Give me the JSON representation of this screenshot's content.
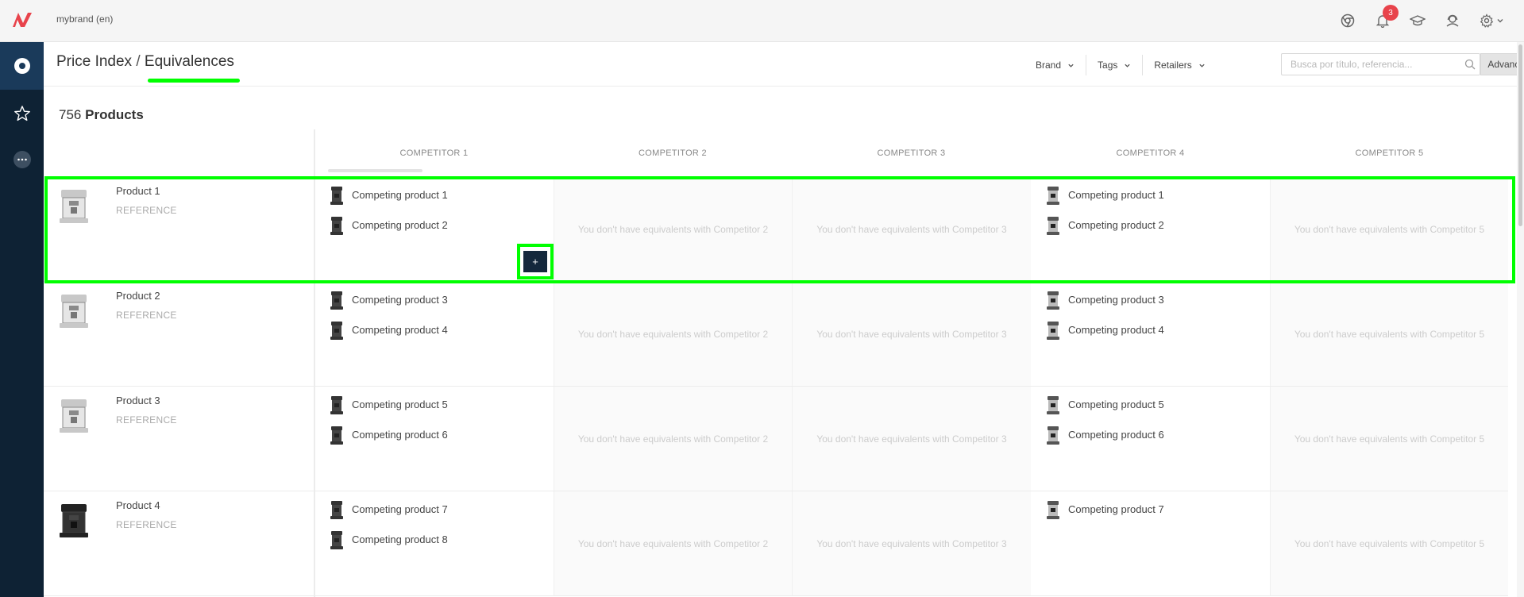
{
  "topbar": {
    "brand_label": "mybrand (en)",
    "notification_count": "3",
    "icons": [
      "chrome-icon",
      "bell-icon",
      "graduation-cap-icon",
      "user-support-icon",
      "gear-icon"
    ]
  },
  "sidebar": {
    "items": [
      {
        "icon": "circle-dot-icon",
        "active": true
      },
      {
        "icon": "star-icon",
        "active": false
      },
      {
        "icon": "more-icon",
        "active": false
      }
    ]
  },
  "header": {
    "breadcrumb_parent": "Price Index",
    "separator": "/",
    "breadcrumb_current": "Equivalences",
    "filters": [
      "Brand",
      "Tags",
      "Retailers"
    ],
    "search_placeholder": "Busca por título, referencia...",
    "advanced_label": "Advanced"
  },
  "summary": {
    "count": "756",
    "label": "Products"
  },
  "competitors": [
    "COMPETITOR 1",
    "COMPETITOR 2",
    "COMPETITOR 3",
    "COMPETITOR 4",
    "COMPETITOR 5"
  ],
  "rows": [
    {
      "name": "Product 1",
      "ref": "REFERENCE",
      "cells": [
        [
          "Competing product 1",
          "Competing product 2"
        ],
        "You don't have equivalents with Competitor 2",
        "You don't have equivalents with Competitor 3",
        [
          "Competing product 1",
          "Competing product 2"
        ],
        "You don't have equivalents with Competitor 5"
      ]
    },
    {
      "name": "Product 2",
      "ref": "REFERENCE",
      "cells": [
        [
          "Competing product 3",
          "Competing product 4"
        ],
        "You don't have equivalents with Competitor 2",
        "You don't have equivalents with Competitor 3",
        [
          "Competing product 3",
          "Competing product 4"
        ],
        "You don't have equivalents with Competitor 5"
      ]
    },
    {
      "name": "Product 3",
      "ref": "REFERENCE",
      "cells": [
        [
          "Competing product 5",
          "Competing product 6"
        ],
        "You don't have equivalents with Competitor 2",
        "You don't have equivalents with Competitor 3",
        [
          "Competing product 5",
          "Competing product 6"
        ],
        "You don't have equivalents with Competitor 5"
      ]
    },
    {
      "name": "Product 4",
      "ref": "REFERENCE",
      "cells": [
        [
          "Competing product 7",
          "Competing product 8"
        ],
        "You don't have equivalents with Competitor 2",
        "You don't have equivalents with Competitor 3",
        [
          "Competing product 7"
        ],
        "You don't have equivalents with Competitor 5"
      ]
    }
  ],
  "add_button_label": "+",
  "colors": {
    "sidebar": "#0e2234",
    "sidebar_active": "#1a3a5a",
    "accent_highlight": "#00ff00",
    "badge": "#e8434b",
    "logo": "#e8434b",
    "add_button": "#14283c"
  }
}
